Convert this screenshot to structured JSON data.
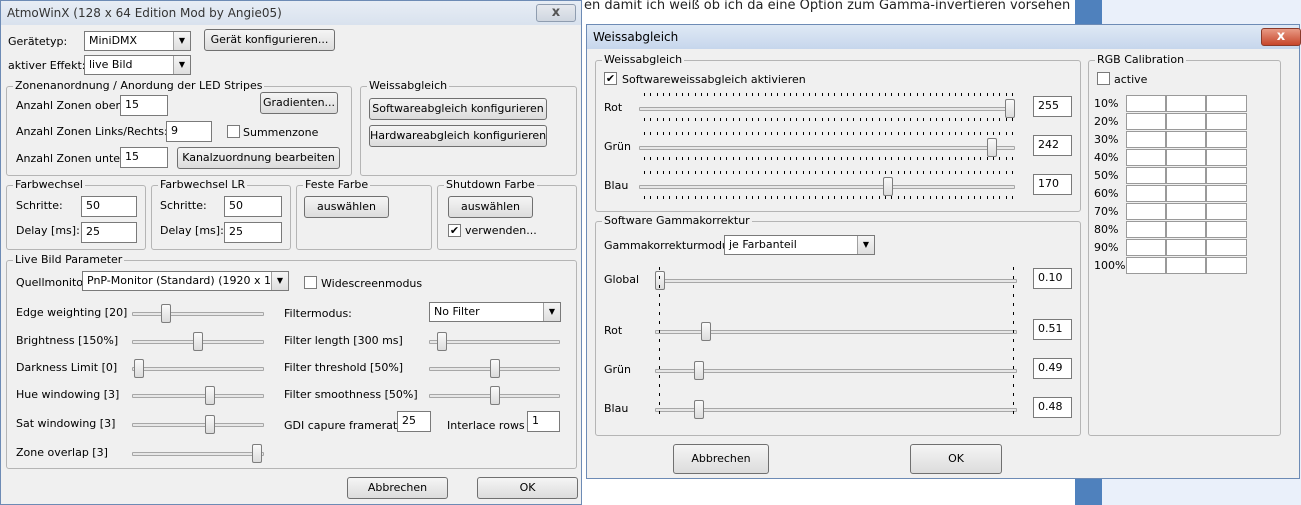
{
  "background": {
    "text": "en damit ich weiß ob ich da eine Option zum Gamma-invertieren vorsehen"
  },
  "main": {
    "title": "AtmoWinX (128 x 64 Edition Mod by Angie05)",
    "close_label": "x",
    "device_type_label": "Gerätetyp:",
    "device_type_value": "MiniDMX",
    "configure_device_button": "Gerät konfigurieren...",
    "active_effect_label": "aktiver Effekt:",
    "active_effect_value": "live Bild",
    "zones": {
      "legend": "Zonenanordnung / Anordung der LED Stripes",
      "top_label": "Anzahl Zonen oben:",
      "top_value": "15",
      "gradients_button": "Gradienten...",
      "leftright_label": "Anzahl Zonen Links/Rechts:",
      "leftright_value": "9",
      "sumzone_label": "Summenzone",
      "bottom_label": "Anzahl Zonen unten:",
      "bottom_value": "15",
      "channel_button": "Kanalzuordnung bearbeiten"
    },
    "whitebalance": {
      "legend": "Weissabgleich",
      "software_button": "Softwareabgleich konfigurieren",
      "hardware_button": "Hardwareabgleich konfigurieren"
    },
    "colorchange": {
      "legend": "Farbwechsel",
      "steps_label": "Schritte:",
      "steps_value": "50",
      "delay_label": "Delay [ms]:",
      "delay_value": "25"
    },
    "colorchange_lr": {
      "legend": "Farbwechsel LR",
      "steps_label": "Schritte:",
      "steps_value": "50",
      "delay_label": "Delay [ms]:",
      "delay_value": "25"
    },
    "fixed_color": {
      "legend": "Feste Farbe",
      "select_button": "auswählen"
    },
    "shutdown_color": {
      "legend": "Shutdown Farbe",
      "select_button": "auswählen",
      "use_label": "verwenden...",
      "use_checked": "✔"
    },
    "live": {
      "legend": "Live Bild Parameter",
      "source_label": "Quellmonitor:",
      "source_value": "PnP-Monitor (Standard) (1920 x 1080)",
      "widescreen_label": "Widescreenmodus",
      "filter_mode_label": "Filtermodus:",
      "filter_mode_value": "No Filter",
      "gdi_label": "GDI capure framerate",
      "gdi_value": "25",
      "interlace_label": "Interlace rows",
      "interlace_value": "1",
      "sliders_left": [
        {
          "label": "Edge weighting [20]",
          "level": 0.24
        },
        {
          "label": "Brightness [150%]",
          "level": 0.5
        },
        {
          "label": "Darkness Limit [0]",
          "level": 0.02
        },
        {
          "label": "Hue windowing [3]",
          "level": 0.6
        },
        {
          "label": "Sat windowing [3]",
          "level": 0.6
        },
        {
          "label": "Zone overlap [3]",
          "level": 0.98
        }
      ],
      "sliders_right": [
        {
          "label": "Filter length [300 ms]",
          "level": 0.07
        },
        {
          "label": "Filter threshold [50%]",
          "level": 0.5
        },
        {
          "label": "Filter smoothness [50%]",
          "level": 0.5
        }
      ]
    },
    "cancel_button": "Abbrechen",
    "ok_button": "OK"
  },
  "dialog": {
    "title": "Weissabgleich",
    "close_label": "x",
    "wb": {
      "legend": "Weissabgleich",
      "enable_label": "Softwareweissabgleich aktivieren",
      "enable_checked": "✔",
      "channels": [
        {
          "label": "Rot",
          "value": "255",
          "level": 1.0
        },
        {
          "label": "Grün",
          "value": "242",
          "level": 0.95
        },
        {
          "label": "Blau",
          "value": "170",
          "level": 0.667
        }
      ]
    },
    "gamma": {
      "legend": "Software Gammakorrektur",
      "mode_label": "Gammakorrekturmodus:",
      "mode_value": "je Farbanteil",
      "channels": [
        {
          "label": "Global",
          "value": "0.10",
          "level": 0.0
        },
        {
          "label": "Rot",
          "value": "0.51",
          "level": 0.13
        },
        {
          "label": "Grün",
          "value": "0.49",
          "level": 0.11
        },
        {
          "label": "Blau",
          "value": "0.48",
          "level": 0.11
        }
      ]
    },
    "rgb": {
      "legend": "RGB Calibration",
      "active_label": "active",
      "rows": [
        "10%",
        "20%",
        "30%",
        "40%",
        "50%",
        "60%",
        "70%",
        "80%",
        "90%",
        "100%"
      ]
    },
    "cancel_button": "Abbrechen",
    "ok_button": "OK"
  }
}
